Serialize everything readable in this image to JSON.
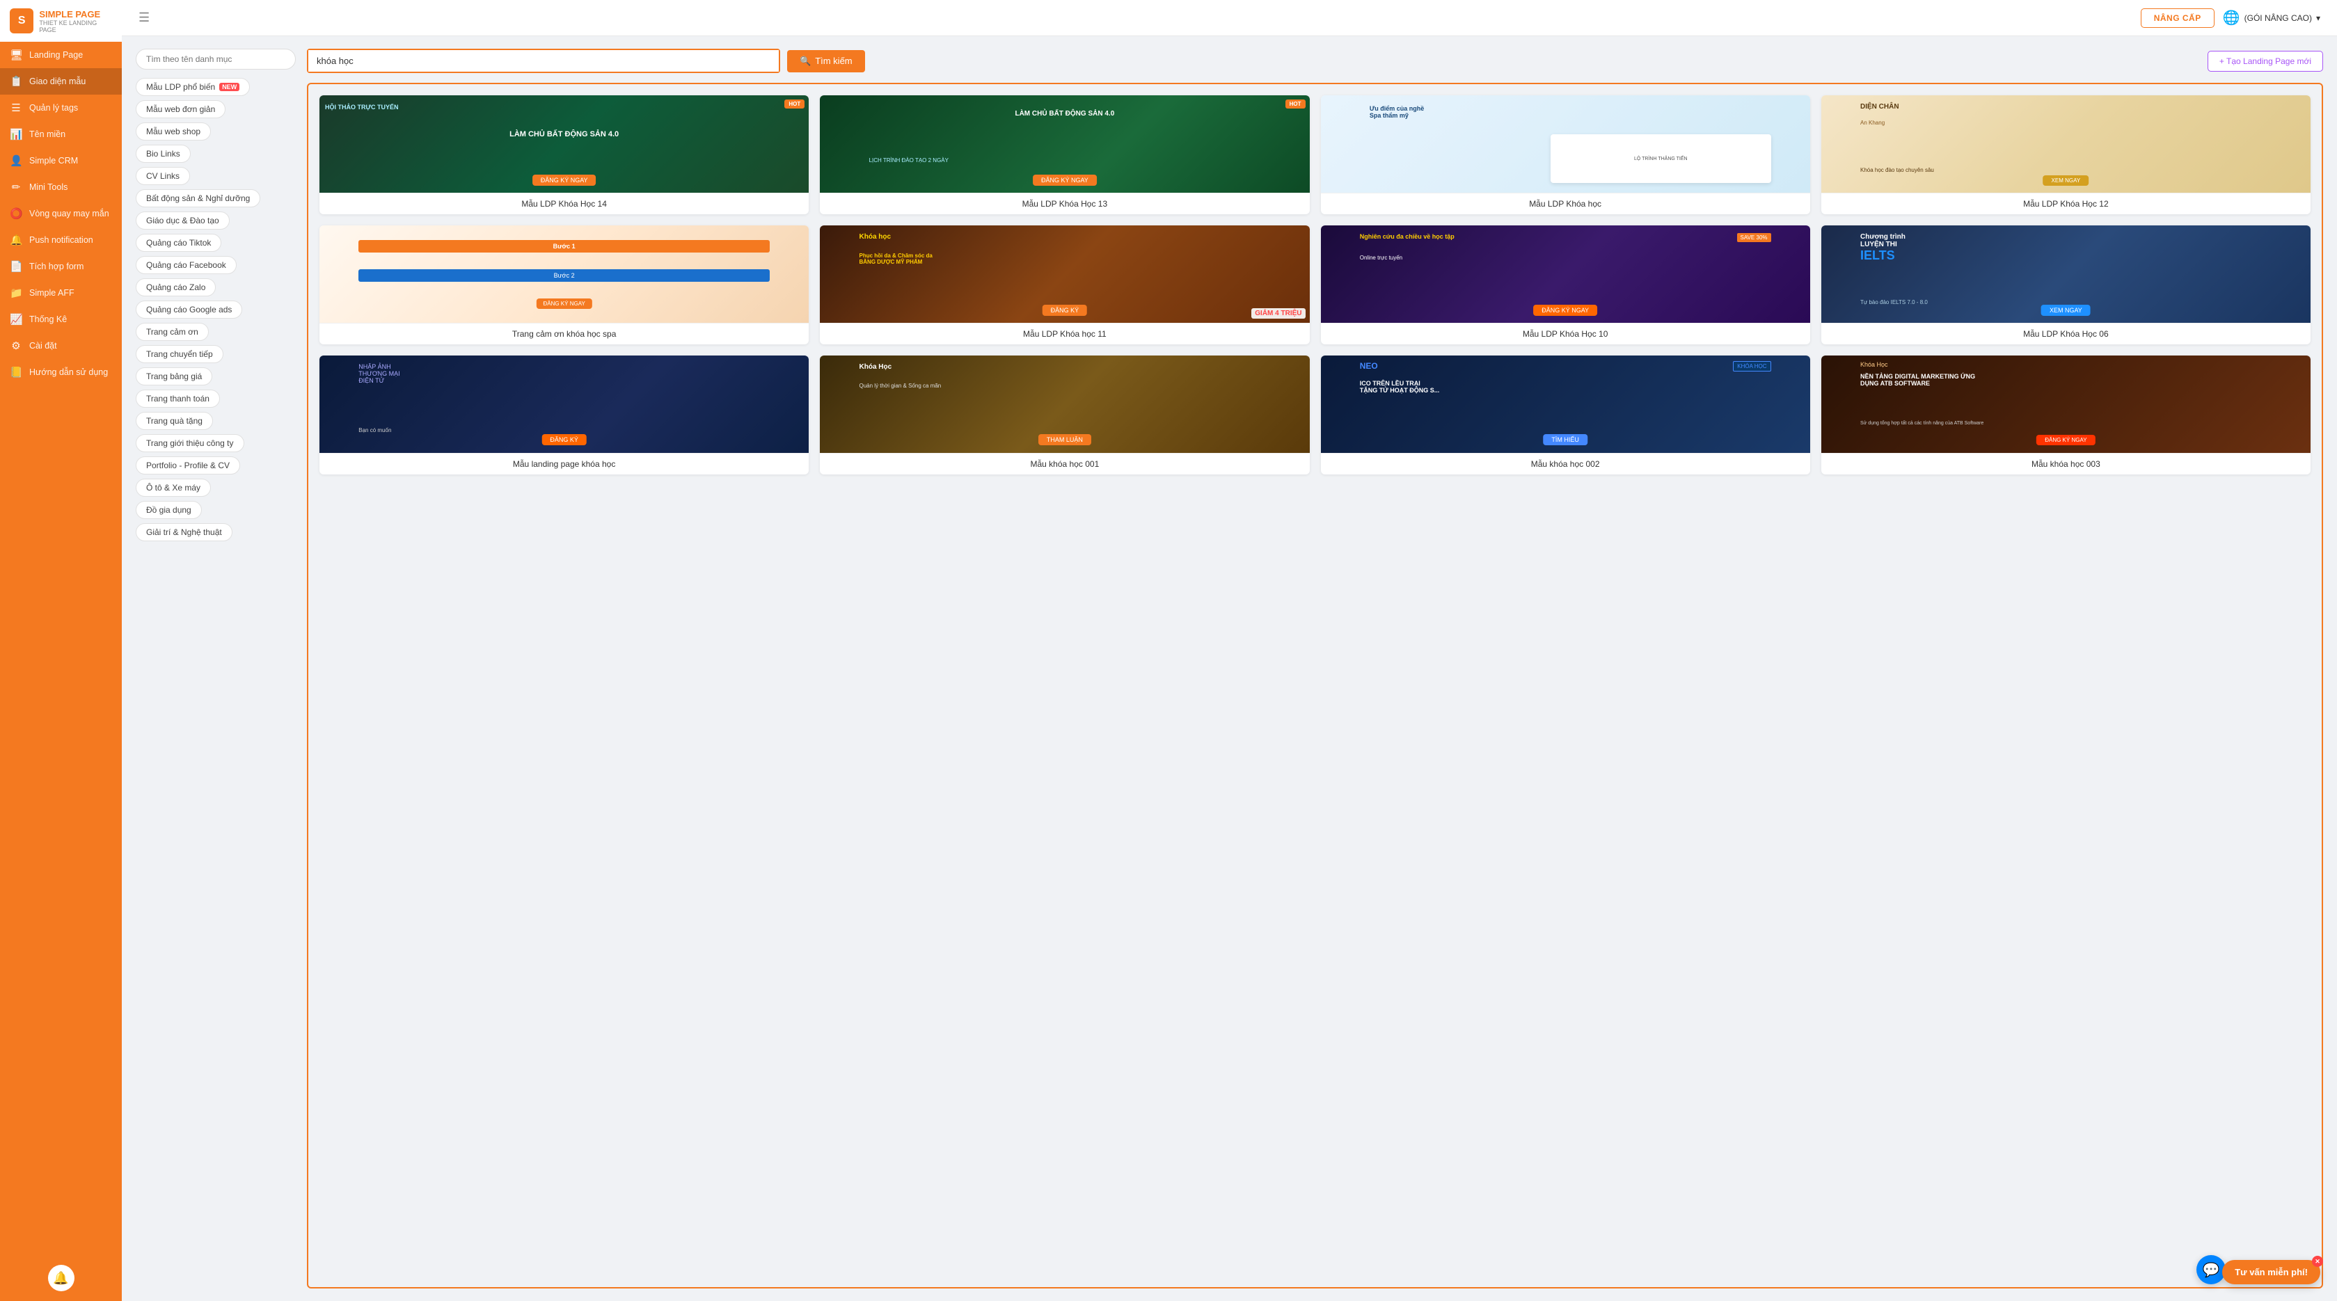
{
  "app": {
    "brand": "SIMPLE PAGE",
    "tagline": "THIET KE LANDING PAGE"
  },
  "header": {
    "upgrade_label": "NÂNG CẤP",
    "plan_label": "(GÓI NÂNG CAO)",
    "menu_icon": "☰"
  },
  "sidebar": {
    "items": [
      {
        "id": "landing-page",
        "label": "Landing Page",
        "icon": "🖥"
      },
      {
        "id": "giao-dien-mau",
        "label": "Giao diện mẫu",
        "icon": "📋",
        "active": true
      },
      {
        "id": "quan-ly-tags",
        "label": "Quản lý tags",
        "icon": "☰"
      },
      {
        "id": "ten-mien",
        "label": "Tên miền",
        "icon": "📊"
      },
      {
        "id": "simple-crm",
        "label": "Simple CRM",
        "icon": "👤"
      },
      {
        "id": "mini-tools",
        "label": "Mini Tools",
        "icon": "✏"
      },
      {
        "id": "vong-quay",
        "label": "Vòng quay may mắn",
        "icon": "⭕"
      },
      {
        "id": "push-notification",
        "label": "Push notification",
        "icon": "🔔"
      },
      {
        "id": "tich-hop-form",
        "label": "Tích hợp form",
        "icon": "📄"
      },
      {
        "id": "simple-aff",
        "label": "Simple AFF",
        "icon": "📁"
      },
      {
        "id": "thong-ke",
        "label": "Thống Kê",
        "icon": "📈"
      },
      {
        "id": "cai-dat",
        "label": "Cài đặt",
        "icon": "⚙"
      },
      {
        "id": "huong-dan",
        "label": "Hướng dẫn sử dụng",
        "icon": "📒"
      }
    ]
  },
  "search": {
    "category_placeholder": "Tìm theo tên danh mục",
    "search_value": "khóa học",
    "search_button": "Tìm kiếm"
  },
  "create_button": "+ Tạo Landing Page mới",
  "categories": [
    {
      "id": "mau-ldp-pho-bien",
      "label": "Mẫu LDP phổ biến",
      "new": true
    },
    {
      "id": "mau-web-don-gian",
      "label": "Mẫu web đơn giản"
    },
    {
      "id": "mau-web-shop",
      "label": "Mẫu web shop"
    },
    {
      "id": "bio-links",
      "label": "Bio Links"
    },
    {
      "id": "cv-links",
      "label": "CV Links"
    },
    {
      "id": "bat-dong-san",
      "label": "Bất động sản & Nghỉ dưỡng"
    },
    {
      "id": "giao-duc",
      "label": "Giáo dục & Đào tạo"
    },
    {
      "id": "quang-cao-tiktok",
      "label": "Quảng cáo Tiktok"
    },
    {
      "id": "quang-cao-facebook",
      "label": "Quảng cáo Facebook"
    },
    {
      "id": "quang-cao-zalo",
      "label": "Quảng cáo Zalo"
    },
    {
      "id": "quang-cao-google",
      "label": "Quảng cáo Google ads"
    },
    {
      "id": "trang-cam-on",
      "label": "Trang cảm ơn"
    },
    {
      "id": "trang-chuyen-tiep",
      "label": "Trang chuyển tiếp"
    },
    {
      "id": "trang-bang-gia",
      "label": "Trang bảng giá"
    },
    {
      "id": "trang-thanh-toan",
      "label": "Trang thanh toán"
    },
    {
      "id": "trang-qua-tang",
      "label": "Trang quà tặng"
    },
    {
      "id": "trang-gioi-thieu",
      "label": "Trang giới thiệu công ty"
    },
    {
      "id": "portfolio",
      "label": "Portfolio - Profile & CV"
    },
    {
      "id": "o-to-xe-may",
      "label": "Ô tô & Xe máy"
    },
    {
      "id": "do-gia-dung",
      "label": "Đồ gia dụng"
    },
    {
      "id": "giai-tri",
      "label": "Giải trí & Nghệ thuật"
    }
  ],
  "results": [
    {
      "id": 1,
      "label": "Mẫu LDP Khóa Học 14",
      "thumb_class": "thumb-1"
    },
    {
      "id": 2,
      "label": "Mẫu LDP Khóa Học 13",
      "thumb_class": "thumb-2"
    },
    {
      "id": 3,
      "label": "Mẫu LDP Khóa học",
      "thumb_class": "thumb-3"
    },
    {
      "id": 4,
      "label": "Mẫu LDP Khóa Học 12",
      "thumb_class": "thumb-4"
    },
    {
      "id": 5,
      "label": "Trang cảm ơn khóa học spa",
      "thumb_class": "thumb-5"
    },
    {
      "id": 6,
      "label": "Mẫu LDP Khóa học 11",
      "thumb_class": "thumb-6"
    },
    {
      "id": 7,
      "label": "Mẫu LDP Khóa Học 10",
      "thumb_class": "thumb-7"
    },
    {
      "id": 8,
      "label": "Mẫu LDP Khóa Học 06",
      "thumb_class": "thumb-8"
    },
    {
      "id": 9,
      "label": "Mẫu landing page khóa học",
      "thumb_class": "thumb-9"
    },
    {
      "id": 10,
      "label": "Mẫu khóa học 001",
      "thumb_class": "thumb-10"
    },
    {
      "id": 11,
      "label": "Mẫu khóa học 002",
      "thumb_class": "thumb-11"
    },
    {
      "id": 12,
      "label": "Mẫu khóa học 003",
      "thumb_class": "thumb-12"
    }
  ],
  "chat": {
    "label": "Tư vấn miễn phí!"
  },
  "icons": {
    "search": "🔍",
    "bell": "🔔",
    "chat": "💬",
    "globe": "🌐",
    "chevron_down": "▾"
  }
}
